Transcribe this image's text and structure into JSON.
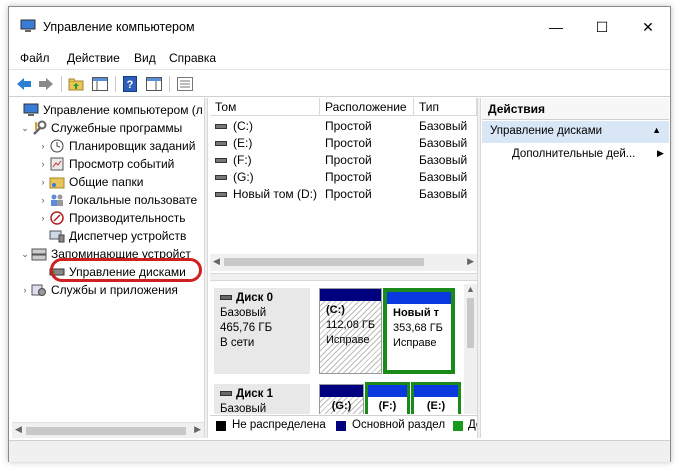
{
  "window": {
    "title": "Управление компьютером",
    "controls": {
      "minimize": "—",
      "maximize": "☐",
      "close": "✕"
    }
  },
  "menu": [
    "Файл",
    "Действие",
    "Вид",
    "Справка"
  ],
  "toolbar": {
    "icons": [
      "back-arrow-icon",
      "forward-arrow-icon",
      "up-folder-icon",
      "console-tree-icon",
      "help-icon",
      "properties-icon",
      "list-icon"
    ]
  },
  "tree": {
    "root": "Управление компьютером (л",
    "system_tools": "Служебные программы",
    "task_scheduler": "Планировщик заданий",
    "event_viewer": "Просмотр событий",
    "shared_folders": "Общие папки",
    "local_users": "Локальные пользовате",
    "performance": "Производительность",
    "device_manager": "Диспетчер устройств",
    "storage": "Запоминающие устройст",
    "disk_management": "Управление дисками",
    "services": "Службы и приложения"
  },
  "volume_list": {
    "columns": [
      "Том",
      "Расположение",
      "Тип"
    ],
    "rows": [
      {
        "volume": "(C:)",
        "layout": "Простой",
        "type": "Базовый"
      },
      {
        "volume": "(E:)",
        "layout": "Простой",
        "type": "Базовый"
      },
      {
        "volume": "(F:)",
        "layout": "Простой",
        "type": "Базовый"
      },
      {
        "volume": "(G:)",
        "layout": "Простой",
        "type": "Базовый"
      },
      {
        "volume": "Новый том (D:)",
        "layout": "Простой",
        "type": "Базовый"
      }
    ]
  },
  "disks": [
    {
      "name": "Диск 0",
      "type": "Базовый",
      "size": "465,76 ГБ",
      "status": "В сети",
      "partitions": [
        {
          "label": "(C:)",
          "size": "112,08 ГБ",
          "status": "Исправе"
        },
        {
          "label": "Новый т",
          "size": "353,68 ГБ",
          "status": "Исправе"
        }
      ]
    },
    {
      "name": "Диск 1",
      "type": "Базовый",
      "partitions": [
        {
          "label": "(G:)"
        },
        {
          "label": "(F:)"
        },
        {
          "label": "(E:)"
        }
      ]
    }
  ],
  "legend": [
    {
      "label": "Не распределена",
      "color": "#000000"
    },
    {
      "label": "Основной раздел",
      "color": "#00007f"
    },
    {
      "label": "До",
      "color": "#1a9a1a"
    }
  ],
  "actions": {
    "header": "Действия",
    "section": "Управление дисками",
    "more": "Дополнительные дей..."
  },
  "colors": {
    "highlight_ring": "#d01f1f",
    "selected_green": "#1a8a1a",
    "primary_partition": "#00007f",
    "logical_partition": "#0b39e0",
    "actions_section_bg": "#d8e6f5"
  }
}
